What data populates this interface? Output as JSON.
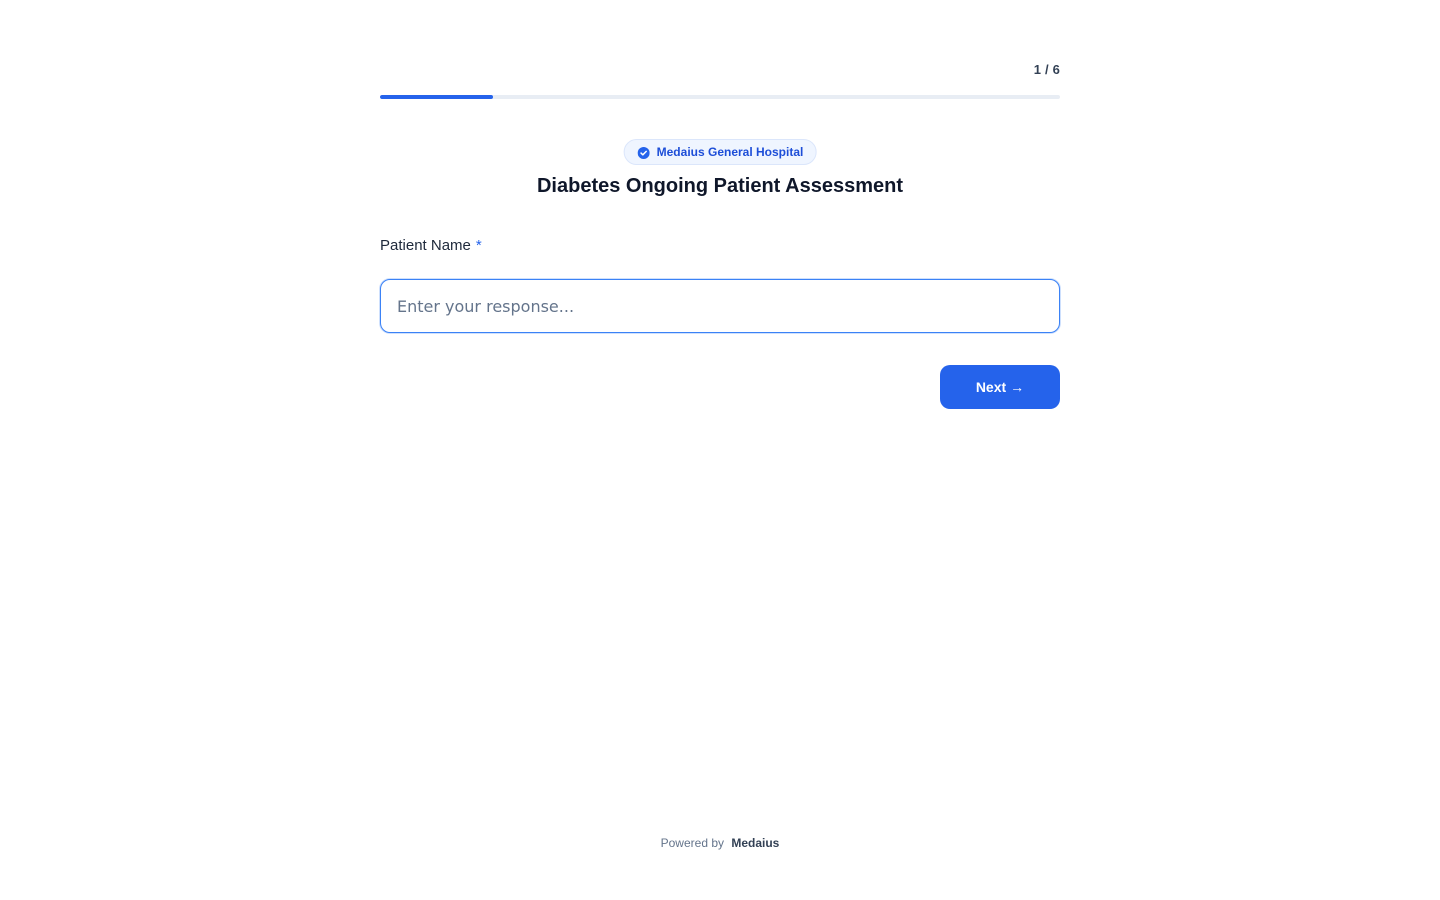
{
  "progress": {
    "step_label": "1 / 6",
    "fraction": 0.1667,
    "color": "#2563eb"
  },
  "header": {
    "organization": "Medaius General Hospital",
    "badge_icon": "check-circle-icon",
    "title": "Diabetes Ongoing Patient Assessment"
  },
  "question": {
    "label": "Patient Name",
    "required_mark": "*",
    "placeholder": "Enter your response...",
    "value": ""
  },
  "actions": {
    "next_label": "Next",
    "next_icon": "→"
  },
  "footer": {
    "powered_by": "Powered by",
    "brand": "Medaius"
  },
  "colors": {
    "accent": "#2563eb",
    "title": "#0f172a",
    "muted": "#64748b"
  }
}
